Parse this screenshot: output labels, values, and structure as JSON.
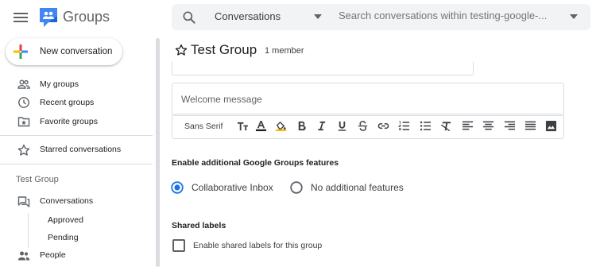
{
  "header": {
    "app_title": "Groups",
    "search": {
      "scope": "Conversations",
      "placeholder": "Search conversations within testing-google-..."
    }
  },
  "sidebar": {
    "new_conversation": "New conversation",
    "items": [
      {
        "label": "My groups",
        "icon": "people-outline-icon"
      },
      {
        "label": "Recent groups",
        "icon": "clock-icon"
      },
      {
        "label": "Favorite groups",
        "icon": "folder-star-icon"
      },
      {
        "label": "Starred conversations",
        "icon": "star-outline-icon"
      }
    ],
    "group_section": {
      "title": "Test Group",
      "items": [
        {
          "label": "Conversations",
          "icon": "forum-icon"
        },
        {
          "label": "Approved"
        },
        {
          "label": "Pending"
        },
        {
          "label": "People",
          "icon": "people-icon"
        }
      ]
    }
  },
  "main": {
    "group_title": "Test Group",
    "member_count": "1 member",
    "welcome_placeholder": "Welcome message",
    "editor": {
      "font": "Sans Serif",
      "buttons": [
        "text-size-icon",
        "text-color-icon",
        "highlight-icon",
        "bold-icon",
        "italic-icon",
        "underline-icon",
        "strikethrough-icon",
        "link-icon",
        "numbered-list-icon",
        "bulleted-list-icon",
        "clear-format-icon",
        "align-left-icon",
        "align-center-icon",
        "align-right-icon",
        "justify-icon",
        "image-icon"
      ]
    },
    "features": {
      "heading": "Enable additional Google Groups features",
      "options": [
        {
          "label": "Collaborative Inbox",
          "selected": true
        },
        {
          "label": "No additional features",
          "selected": false
        }
      ]
    },
    "shared_labels": {
      "heading": "Shared labels",
      "checkbox_label": "Enable shared labels for this group",
      "checked": false
    }
  },
  "colors": {
    "accent": "#1a73e8",
    "icon_gray": "#5f6368",
    "divider": "#dadce0"
  }
}
